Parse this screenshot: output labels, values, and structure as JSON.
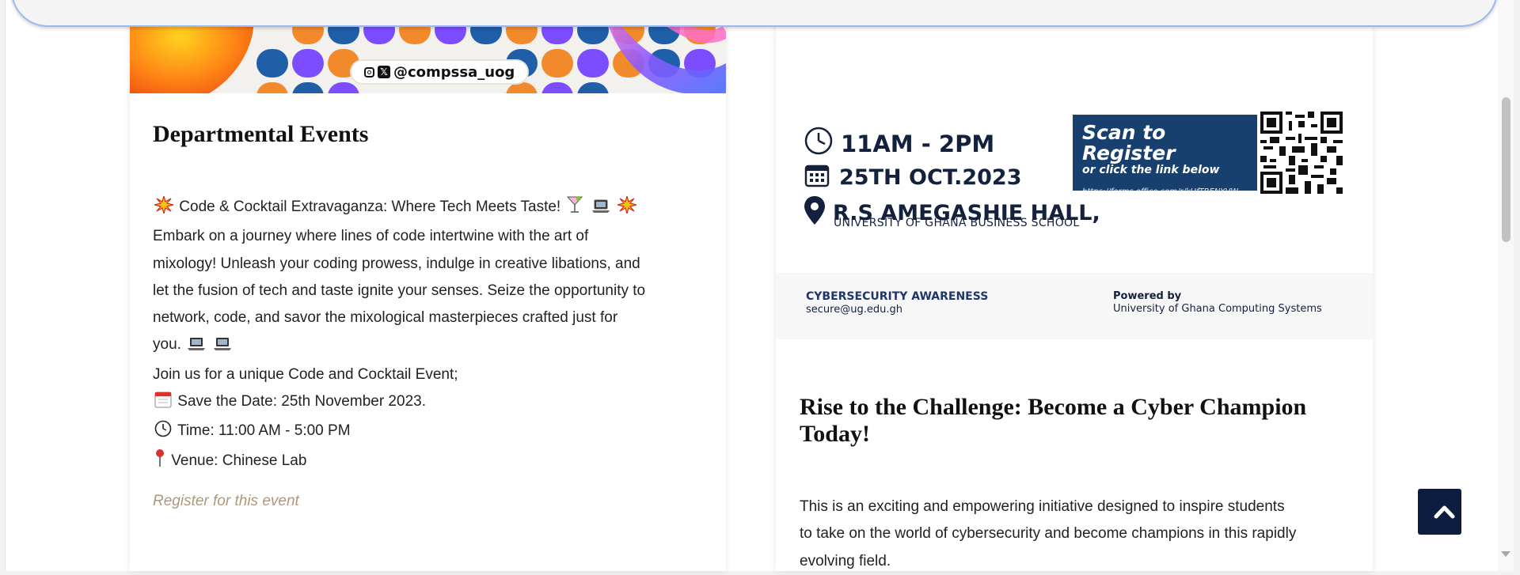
{
  "left_card": {
    "banner": {
      "handle": "@compssa_uog"
    },
    "title": "Departmental Events",
    "lines": [
      "Code & Cocktail Extravaganza: Where Tech Meets Taste!",
      "Embark on a journey where lines of code intertwine with the art of",
      "mixology! Unleash your coding prowess, indulge in creative libations, and",
      "let the fusion of tech and taste ignite your senses. Seize the opportunity to",
      "network, code, and savor the mixological masterpieces crafted just for",
      "you.",
      "Join us for a unique Code and Cocktail Event;",
      "Save the Date: 25th November 2023.",
      "Time: 11:00 AM - 5:00 PM",
      "Venue: Chinese Lab"
    ],
    "register_link": "Register for this event"
  },
  "right_card": {
    "poster": {
      "time": "11AM - 2PM",
      "date": "25TH OCT.2023",
      "venue": "R.S AMEGASHIE HALL,",
      "venue_sub": "UNIVERSITY OF GHANA BUSINESS SCHOOL",
      "scan_title": "Scan to Register",
      "scan_sub": "or click the link below",
      "scan_url": "https://forms.office.com/r/kUfTRENYVW",
      "foot_left_title": "CYBERSECURITY AWARENESS",
      "foot_left_email": "secure@ug.edu.gh",
      "foot_right_title": "Powered by",
      "foot_right_org": "University of Ghana Computing Systems"
    },
    "title": "Rise to the Challenge: Become a Cyber Champion Today!",
    "lines": [
      "This is an exciting and empowering initiative designed to inspire students",
      "to take on the world of cybersecurity and become champions in this rapidly",
      "evolving field."
    ]
  },
  "icons": {
    "sparkle": "explosion-icon",
    "cocktail": "cocktail-icon",
    "laptop": "laptop-icon",
    "calendar": "calendar-icon",
    "clock": "clock-icon",
    "pin": "pushpin-icon",
    "back_to_top": "chevron-up-icon"
  },
  "colors": {
    "link": "#b0977b",
    "back_to_top_bg": "#0d1d40",
    "poster_navy": "#17406e"
  }
}
